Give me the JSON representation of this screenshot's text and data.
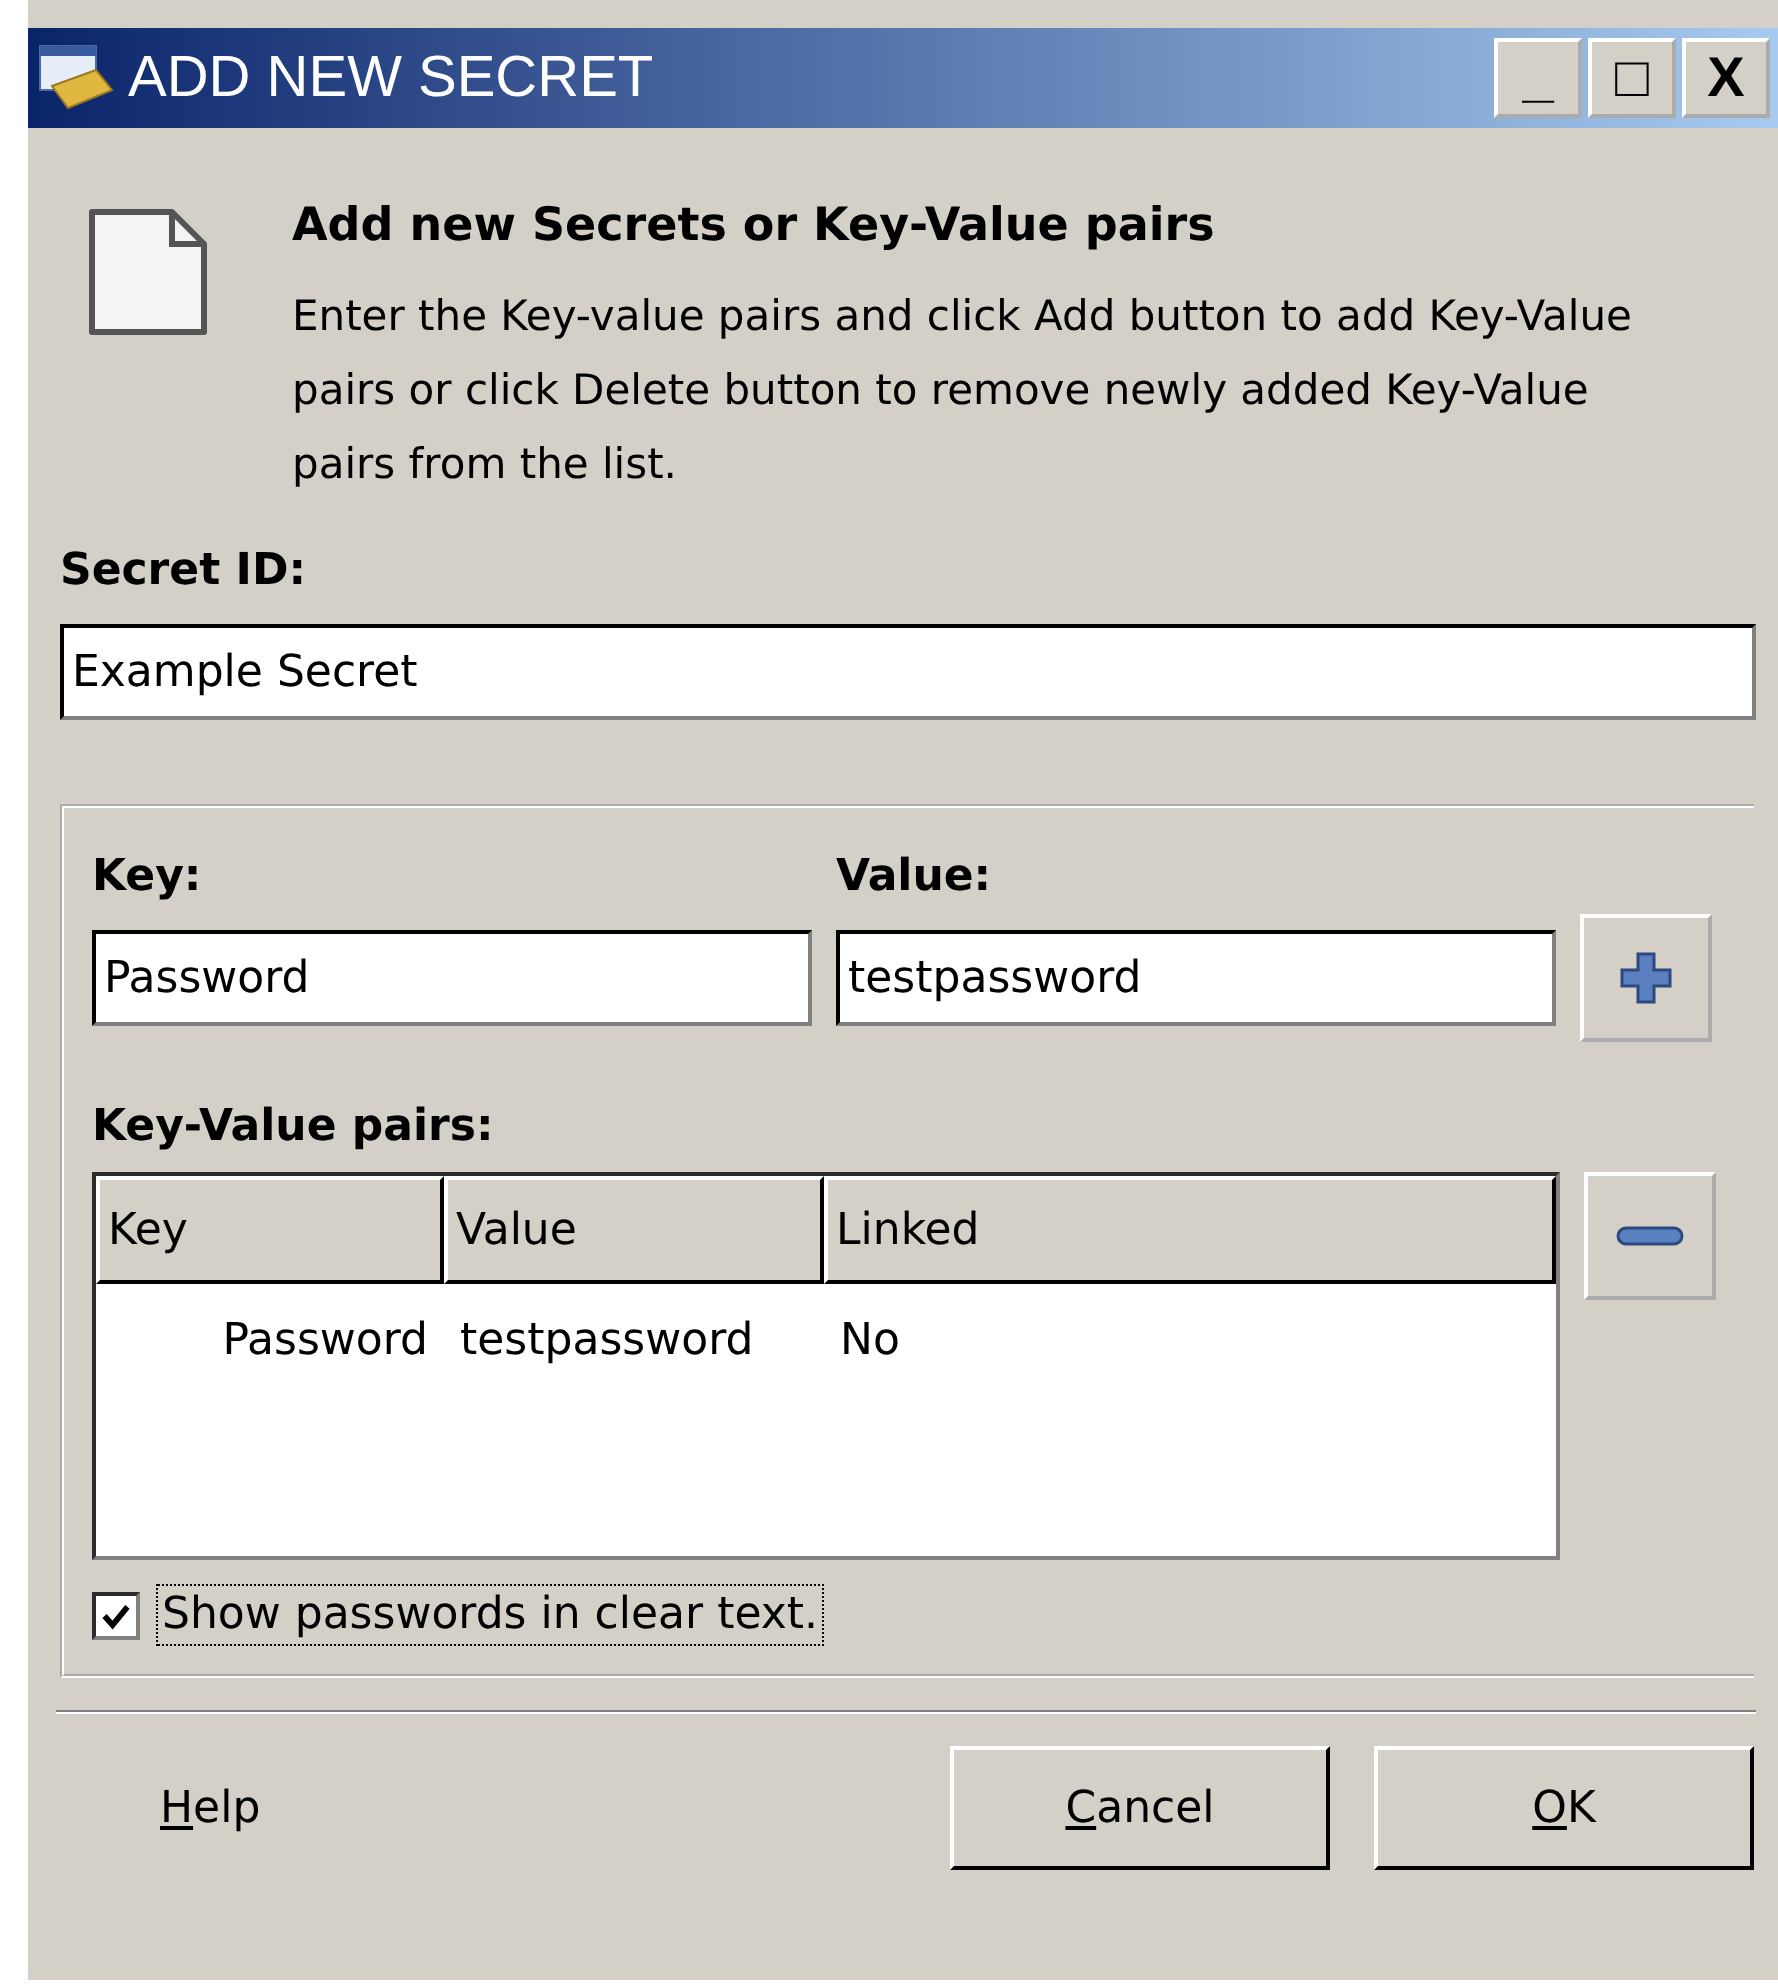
{
  "window": {
    "title": "ADD NEW SECRET",
    "controls": [
      "_",
      "□",
      "X"
    ]
  },
  "header": {
    "title": "Add new Secrets or Key-Value pairs",
    "description": "Enter the Key-value pairs and click Add button to add Key-Value pairs or click Delete button to remove newly added Key-Value pairs from the list."
  },
  "secret_id": {
    "label": "Secret ID:",
    "value": "Example Secret"
  },
  "key": {
    "label": "Key:",
    "value": "Password"
  },
  "value": {
    "label": "Value:",
    "value": "testpassword"
  },
  "pairs": {
    "label": "Key-Value pairs:",
    "columns": [
      "Key",
      "Value",
      "Linked"
    ],
    "rows": [
      [
        "Password",
        "testpassword",
        "No"
      ]
    ]
  },
  "show_passwords": {
    "label": "Show passwords in clear text.",
    "checked": true
  },
  "buttons": [
    {
      "kind": "flat",
      "label": "Help"
    },
    {
      "kind": "raised",
      "label": "Cancel"
    },
    {
      "kind": "raised",
      "label": "OK"
    }
  ]
}
